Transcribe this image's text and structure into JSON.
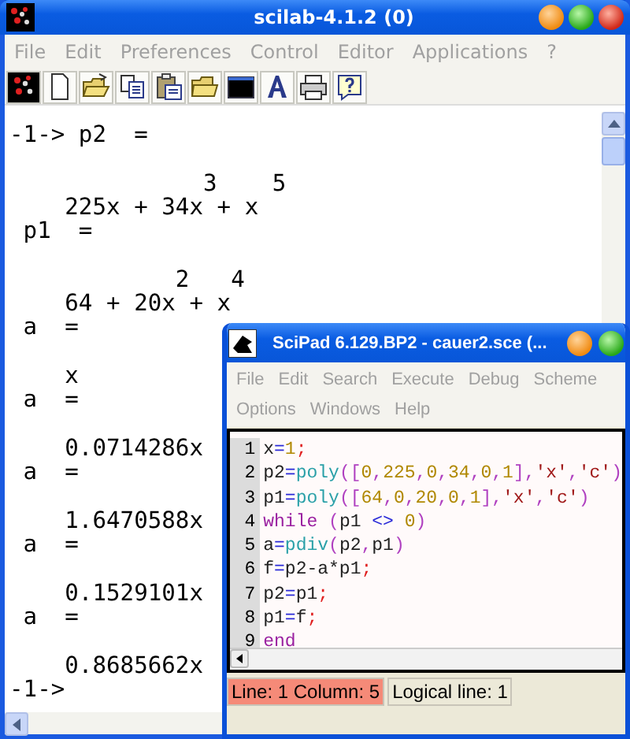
{
  "window": {
    "title": "scilab-4.1.2 (0)"
  },
  "menu": [
    "File",
    "Edit",
    "Preferences",
    "Control",
    "Editor",
    "Applications",
    "?"
  ],
  "toolbar": [
    {
      "kind": "logo"
    },
    {
      "kind": "new"
    },
    {
      "kind": "open"
    },
    {
      "kind": "copy"
    },
    {
      "kind": "paste"
    },
    {
      "kind": "folder"
    },
    {
      "kind": "console"
    },
    {
      "kind": "font"
    },
    {
      "kind": "print"
    },
    {
      "kind": "help"
    }
  ],
  "console": {
    "blocks": [
      [
        "-1-> p2  ="
      ],
      [
        "              3    5",
        "    225x + 34x + x",
        " p1  ="
      ],
      [
        "            2   4",
        "    64 + 20x + x",
        " a  ="
      ],
      [
        "    x",
        " a  ="
      ],
      [
        "    0.0714286x",
        " a  ="
      ],
      [
        "    1.6470588x",
        " a  ="
      ],
      [
        "    0.1529101x",
        " a  ="
      ],
      [
        "    0.8685662x",
        "-1->"
      ]
    ]
  },
  "editor": {
    "title": "SciPad 6.129.BP2 - cauer2.sce (...",
    "menu_rows": [
      [
        "File",
        "Edit",
        "Search",
        "Execute",
        "Debug",
        "Scheme"
      ],
      [
        "Options",
        "Windows",
        "Help"
      ]
    ],
    "lines": [
      {
        "number": "1",
        "tokens": [
          {
            "text": "x",
            "kind": "id"
          },
          {
            "text": "=",
            "kind": "op"
          },
          {
            "text": "1",
            "kind": "num"
          },
          {
            "text": ";",
            "kind": "semi"
          }
        ]
      },
      {
        "number": "2",
        "tokens": [
          {
            "text": "p2",
            "kind": "id"
          },
          {
            "text": "=",
            "kind": "op"
          },
          {
            "text": "poly",
            "kind": "func"
          },
          {
            "text": "([",
            "kind": "delim"
          },
          {
            "text": "0",
            "kind": "num"
          },
          {
            "text": ",",
            "kind": "delim"
          },
          {
            "text": "225",
            "kind": "num"
          },
          {
            "text": ",",
            "kind": "delim"
          },
          {
            "text": "0",
            "kind": "num"
          },
          {
            "text": ",",
            "kind": "delim"
          },
          {
            "text": "34",
            "kind": "num"
          },
          {
            "text": ",",
            "kind": "delim"
          },
          {
            "text": "0",
            "kind": "num"
          },
          {
            "text": ",",
            "kind": "delim"
          },
          {
            "text": "1",
            "kind": "num"
          },
          {
            "text": "],",
            "kind": "delim"
          },
          {
            "text": "'x'",
            "kind": "str"
          },
          {
            "text": ",",
            "kind": "delim"
          },
          {
            "text": "'c'",
            "kind": "str"
          },
          {
            "text": ")",
            "kind": "delim"
          }
        ]
      },
      {
        "number": "3",
        "tokens": [
          {
            "text": "p1",
            "kind": "id"
          },
          {
            "text": "=",
            "kind": "op"
          },
          {
            "text": "poly",
            "kind": "func"
          },
          {
            "text": "([",
            "kind": "delim"
          },
          {
            "text": "64",
            "kind": "num"
          },
          {
            "text": ",",
            "kind": "delim"
          },
          {
            "text": "0",
            "kind": "num"
          },
          {
            "text": ",",
            "kind": "delim"
          },
          {
            "text": "20",
            "kind": "num"
          },
          {
            "text": ",",
            "kind": "delim"
          },
          {
            "text": "0",
            "kind": "num"
          },
          {
            "text": ",",
            "kind": "delim"
          },
          {
            "text": "1",
            "kind": "num"
          },
          {
            "text": "],",
            "kind": "delim"
          },
          {
            "text": "'x'",
            "kind": "str"
          },
          {
            "text": ",",
            "kind": "delim"
          },
          {
            "text": "'c'",
            "kind": "str"
          },
          {
            "text": ")",
            "kind": "delim"
          }
        ]
      },
      {
        "number": "4",
        "tokens": [
          {
            "text": "while",
            "kind": "kw"
          },
          {
            "text": " (",
            "kind": "delim"
          },
          {
            "text": "p1",
            "kind": "id"
          },
          {
            "text": " <> ",
            "kind": "op"
          },
          {
            "text": "0",
            "kind": "num"
          },
          {
            "text": ")",
            "kind": "delim"
          }
        ]
      },
      {
        "number": "5",
        "tokens": [
          {
            "text": "a",
            "kind": "id"
          },
          {
            "text": "=",
            "kind": "op"
          },
          {
            "text": "pdiv",
            "kind": "func"
          },
          {
            "text": "(",
            "kind": "delim"
          },
          {
            "text": "p2",
            "kind": "id"
          },
          {
            "text": ",",
            "kind": "delim"
          },
          {
            "text": "p1",
            "kind": "id"
          },
          {
            "text": ")",
            "kind": "delim"
          }
        ]
      },
      {
        "number": "6",
        "tokens": [
          {
            "text": "f",
            "kind": "id"
          },
          {
            "text": "=",
            "kind": "op"
          },
          {
            "text": "p2-a*p1",
            "kind": "id"
          },
          {
            "text": ";",
            "kind": "semi"
          }
        ]
      },
      {
        "number": "7",
        "tokens": [
          {
            "text": "p2",
            "kind": "id"
          },
          {
            "text": "=",
            "kind": "op"
          },
          {
            "text": "p1",
            "kind": "id"
          },
          {
            "text": ";",
            "kind": "semi"
          }
        ]
      },
      {
        "number": "8",
        "tokens": [
          {
            "text": "p1",
            "kind": "id"
          },
          {
            "text": "=",
            "kind": "op"
          },
          {
            "text": "f",
            "kind": "id"
          },
          {
            "text": ";",
            "kind": "semi"
          }
        ]
      },
      {
        "number": "9",
        "tokens": [
          {
            "text": "end",
            "kind": "kw"
          }
        ]
      }
    ],
    "status": {
      "position": "Line: 1 Column: 5",
      "logical": "Logical line: 1"
    }
  }
}
